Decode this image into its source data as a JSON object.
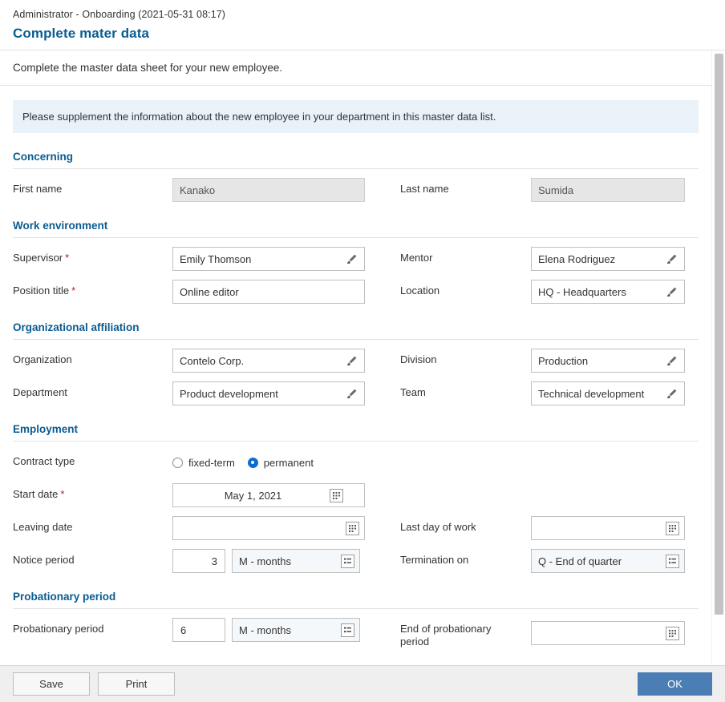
{
  "header": {
    "breadcrumb": "Administrator - Onboarding (2021-05-31 08:17)",
    "title": "Complete mater data"
  },
  "subtitle": "Complete the master data sheet for your new employee.",
  "notice": "Please supplement the information about the new employee in your department in this master data list.",
  "colors": {
    "accent": "#0a5c91",
    "notice_bg": "#e8f2f8",
    "primary_button": "#4a7eb5",
    "required": "#b02020",
    "radio_selected": "#0a6ed1",
    "disabled_field_bg": "#e6e6e6",
    "select_field_bg": "#f5f8fa",
    "footer_bg": "#efefef"
  },
  "sections": {
    "concerning": {
      "title": "Concerning",
      "first_name_label": "First name",
      "first_name_value": "Kanako",
      "last_name_label": "Last name",
      "last_name_value": "Sumida"
    },
    "work_environment": {
      "title": "Work environment",
      "supervisor_label": "Supervisor",
      "supervisor_value": "Emily Thomson",
      "mentor_label": "Mentor",
      "mentor_value": "Elena Rodriguez",
      "position_title_label": "Position title",
      "position_title_value": "Online editor",
      "location_label": "Location",
      "location_value": "HQ - Headquarters"
    },
    "organizational_affiliation": {
      "title": "Organizational affiliation",
      "organization_label": "Organization",
      "organization_value": "Contelo Corp.",
      "division_label": "Division",
      "division_value": "Production",
      "department_label": "Department",
      "department_value": "Product development",
      "team_label": "Team",
      "team_value": "Technical development"
    },
    "employment": {
      "title": "Employment",
      "contract_type_label": "Contract type",
      "contract_options": [
        {
          "label": "fixed-term",
          "selected": false
        },
        {
          "label": "permanent",
          "selected": true
        }
      ],
      "start_date_label": "Start date",
      "start_date_value": "May 1, 2021",
      "leaving_date_label": "Leaving date",
      "leaving_date_value": "",
      "last_day_of_work_label": "Last day of work",
      "last_day_of_work_value": "",
      "notice_period_label": "Notice period",
      "notice_period_value": "3",
      "notice_period_unit": "M - months",
      "termination_on_label": "Termination on",
      "termination_on_value": "Q - End of quarter"
    },
    "probationary_period": {
      "title": "Probationary period",
      "probationary_period_label": "Probationary period",
      "probationary_period_value": "6",
      "probationary_period_unit": "M - months",
      "end_label_line1": "End of probationary",
      "end_label_line2": "period",
      "end_value": ""
    }
  },
  "footer": {
    "save_label": "Save",
    "print_label": "Print",
    "ok_label": "OK"
  },
  "icons": {
    "value_help": "pencil-icon",
    "date_picker": "calendar-icon",
    "dropdown": "list-icon"
  }
}
